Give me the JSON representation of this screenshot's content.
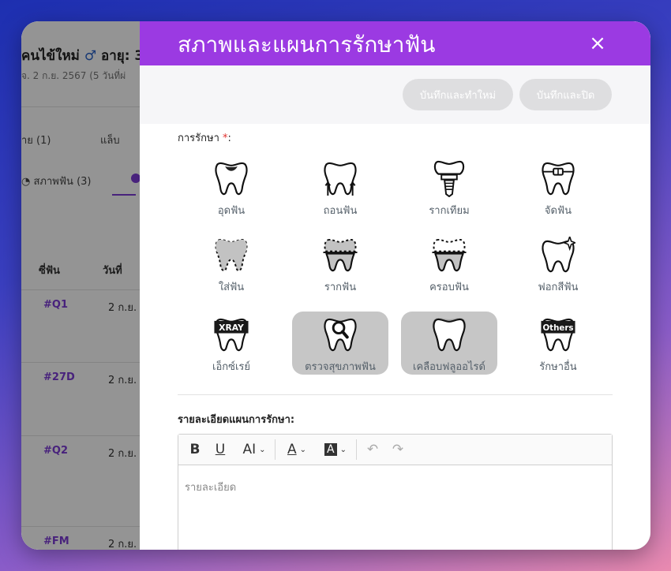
{
  "background": {
    "patient_name": "คนไข้ใหม่",
    "gender_symbol": "♂",
    "age_label": "อายุ: 3",
    "visit_info": "จ. 2 ก.ย. 2567 (5 วันที่ผ่",
    "tabs": [
      "่าย (1)",
      "แล็บ"
    ],
    "subtab": "สภาพฟัน (3)",
    "columns": [
      "ซี่ฟัน",
      "วันที่"
    ],
    "rows": [
      {
        "tooth": "#Q1",
        "date": "2 ก.ย."
      },
      {
        "tooth": "#27D",
        "date": "2 ก.ย."
      },
      {
        "tooth": "#Q2",
        "date": "2 ก.ย."
      },
      {
        "tooth": "#FM",
        "date": "2 ก.ย."
      }
    ]
  },
  "modal": {
    "title": "สภาพและแผนการรักษาฟัน",
    "close": "×",
    "save_new_label": "บันทึกและทำใหม่",
    "save_close_label": "บันทึกและปิด",
    "treatment_label": "การรักษา",
    "required_mark": "*",
    "label_colon": ":",
    "treatments": [
      {
        "label": "อุดฟัน",
        "icon": "tooth-filling-icon",
        "selected": false
      },
      {
        "label": "ถอนฟัน",
        "icon": "tooth-extraction-icon",
        "selected": false
      },
      {
        "label": "รากเทียม",
        "icon": "tooth-implant-icon",
        "selected": false
      },
      {
        "label": "จัดฟัน",
        "icon": "tooth-braces-icon",
        "selected": false
      },
      {
        "label": "ใส่ฟัน",
        "icon": "tooth-denture-icon",
        "selected": false
      },
      {
        "label": "รากฟัน",
        "icon": "tooth-root-canal-icon",
        "selected": false
      },
      {
        "label": "ครอบฟัน",
        "icon": "tooth-crown-icon",
        "selected": false
      },
      {
        "label": "ฟอกสีฟัน",
        "icon": "tooth-whitening-icon",
        "selected": false
      },
      {
        "label": "เอ็กซ์เรย์",
        "icon": "tooth-xray-icon",
        "badge": "XRAY",
        "selected": false
      },
      {
        "label": "ตรวจสุขภาพฟัน",
        "icon": "tooth-checkup-icon",
        "selected": true
      },
      {
        "label": "เคลือบฟลูออไรด์",
        "icon": "tooth-fluoride-icon",
        "selected": true
      },
      {
        "label": "รักษาอื่น",
        "icon": "tooth-others-icon",
        "badge": "Others",
        "selected": false
      }
    ],
    "plan_detail_label": "รายละเอียดแผนการรักษา:",
    "editor_placeholder": "รายละเอียด",
    "toolbar": {
      "bold": "B",
      "underline": "U",
      "font_size": "AI",
      "font_color": "A",
      "highlight": "A"
    }
  }
}
